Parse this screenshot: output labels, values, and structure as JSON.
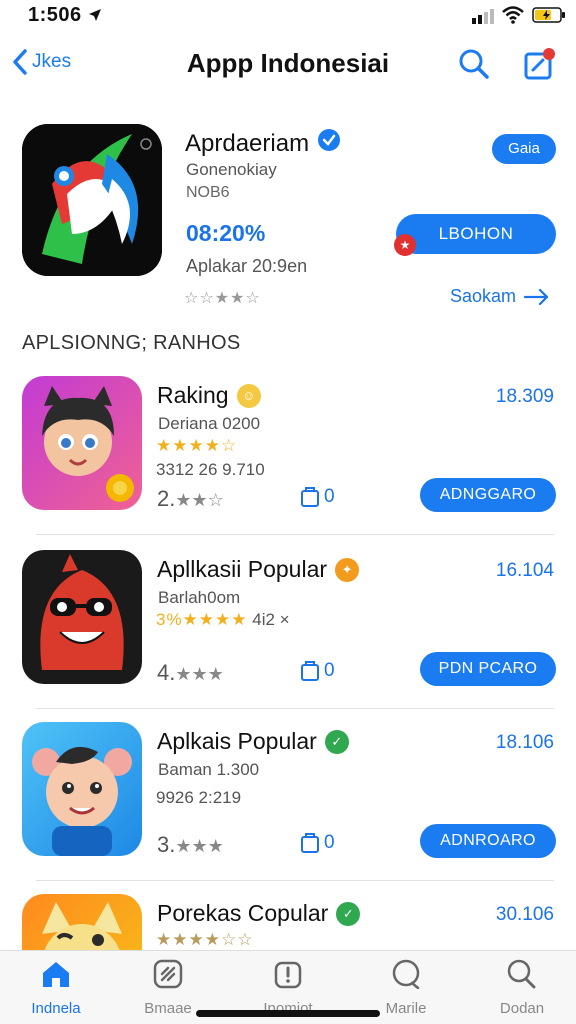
{
  "status": {
    "time": "1:506"
  },
  "nav": {
    "back_label": "Jkes",
    "title": "Appp Indonesiai"
  },
  "featured": {
    "name": "Aprdaeriam",
    "sub1": "Gonenokiay",
    "sub2": "NOB6",
    "pct": "08:20%",
    "meta": "Aplakar 20:9en",
    "stars": "☆☆★★☆",
    "get_label": "Gaia",
    "big_button_label": "LBOHON",
    "red_badge": "★",
    "see_all": "Saokam"
  },
  "section_title": "APLSIONNG; RANHOS",
  "apps": [
    {
      "name": "Raking",
      "line2": "Deriana 0200",
      "line3_stars": "★★★★☆",
      "line4": "3312  26 9.710",
      "rank": "2.",
      "rank_stars": "★★☆",
      "bag": "0",
      "price": "18.309",
      "button": "ADNGGARO",
      "badge_color": "#f5c842",
      "badge_glyph": "☺"
    },
    {
      "name": "Apllkasii Popular",
      "line2": "Barlah0om",
      "line3_stars": "3%★★★★",
      "line3_extra": "4i2  ×",
      "rank": "4.",
      "rank_stars": "★★★",
      "bag": "0",
      "price": "16.104",
      "button": "PDN PCARO",
      "badge_color": "#f29b1d",
      "badge_glyph": "✦"
    },
    {
      "name": "Aplkais Popular",
      "line2": "Baman 1.300",
      "line4": "9926  2:219",
      "rank": "3.",
      "rank_stars": "★★★",
      "bag": "0",
      "price": "18.106",
      "button": "ADNROARO",
      "badge_color": "#2fa84f",
      "badge_glyph": "✓"
    },
    {
      "name": "Porekas Copular",
      "line3_stars": "★★★★☆☆",
      "price": "30.106",
      "badge_color": "#2fa84f",
      "badge_glyph": "✓"
    }
  ],
  "tabs": [
    {
      "label": "Indnela",
      "icon": "today-icon",
      "active": true
    },
    {
      "label": "Bmaae",
      "icon": "games-icon",
      "active": false
    },
    {
      "label": "Inomiot",
      "icon": "apps-icon",
      "active": false
    },
    {
      "label": "Marile",
      "icon": "arcade-icon",
      "active": false
    },
    {
      "label": "Dodan",
      "icon": "search-icon",
      "active": false
    }
  ]
}
